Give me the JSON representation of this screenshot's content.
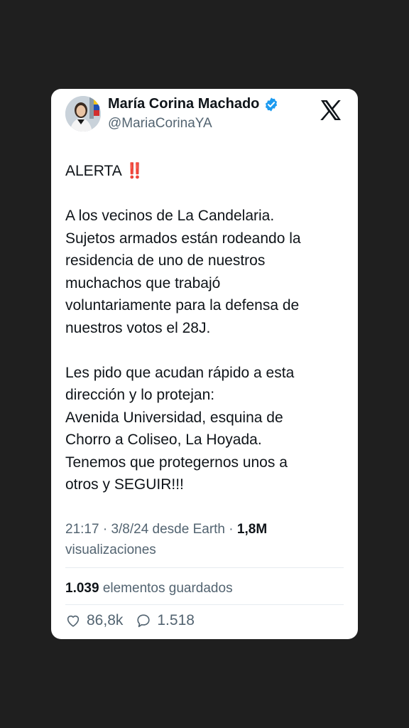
{
  "profile": {
    "name": "María Corina Machado",
    "handle": "@MariaCorinaYA"
  },
  "icons": {
    "verified": "verified-badge-icon",
    "platform": "x-logo-icon",
    "like": "heart-icon",
    "reply": "comment-icon",
    "exclamation": "double-exclamation-icon"
  },
  "tweet": {
    "alert_word": "ALERTA",
    "alert_emoji": "‼️",
    "p1_lines": [
      "A los vecinos de La Candelaria.",
      "Sujetos armados están rodeando la",
      "residencia de uno de nuestros",
      "muchachos que trabajó",
      "voluntariamente para la defensa de",
      "nuestros votos el 28J."
    ],
    "p2_lines": [
      "Les pido que acudan rápido a esta",
      "dirección y lo protejan:",
      "Avenida Universidad, esquina de",
      "Chorro a Coliseo, La Hoyada.",
      "Tenemos que protegernos unos a",
      "otros y SEGUIR!!!"
    ]
  },
  "meta": {
    "time": "21:17",
    "sep1": " · ",
    "date_source": "3/8/24 desde Earth",
    "sep2": " · ",
    "views_count": "1,8M",
    "views_label": "visualizaciones"
  },
  "saved": {
    "count": "1.039",
    "label": "elementos guardados"
  },
  "stats": {
    "likes": "86,8k",
    "replies": "1.518"
  },
  "colors": {
    "background": "#1f1f1f",
    "card": "#ffffff",
    "verified": "#1d9bf0",
    "secondary_text": "#536471",
    "primary_text": "#0f1419",
    "alert_red": "#e0245e"
  }
}
